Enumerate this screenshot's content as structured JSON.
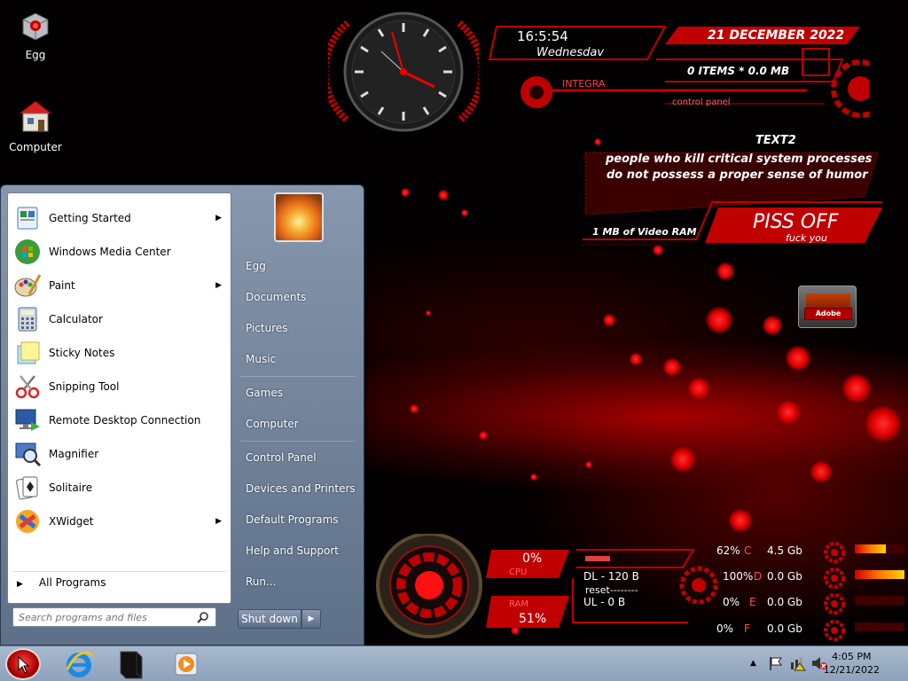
{
  "desktop": {
    "icons": [
      {
        "label": "Egg",
        "icon": "egg-icon"
      },
      {
        "label": "Computer",
        "icon": "computer-icon"
      }
    ],
    "colors": {
      "accent": "#c00000",
      "background": "#020000"
    }
  },
  "widget": {
    "time": "16:5:54",
    "day": "Wednesdav",
    "date": "21 DECEMBER 2022",
    "items": "0 ITEMS * 0.0 MB",
    "integra": "INTEGRA",
    "control_panel": "control  panel",
    "text2_title": "TEXT2",
    "text2_line1": "people who kill critical system processes",
    "text2_line2": "do not possess a proper sense of humor",
    "video_ram": "1 MB of Video RAM",
    "piss_off": "PISS OFF",
    "fuck_you": "fuck you",
    "adobe": "Adobe"
  },
  "start_menu": {
    "programs": [
      {
        "label": "Getting Started",
        "icon": "getting-started-icon",
        "has_submenu": true
      },
      {
        "label": "Windows Media Center",
        "icon": "media-center-icon",
        "has_submenu": false
      },
      {
        "label": "Paint",
        "icon": "paint-icon",
        "has_submenu": true
      },
      {
        "label": "Calculator",
        "icon": "calculator-icon",
        "has_submenu": false
      },
      {
        "label": "Sticky Notes",
        "icon": "sticky-notes-icon",
        "has_submenu": false
      },
      {
        "label": "Snipping Tool",
        "icon": "snipping-tool-icon",
        "has_submenu": false
      },
      {
        "label": "Remote Desktop Connection",
        "icon": "remote-desktop-icon",
        "has_submenu": false
      },
      {
        "label": "Magnifier",
        "icon": "magnifier-icon",
        "has_submenu": false
      },
      {
        "label": "Solitaire",
        "icon": "solitaire-icon",
        "has_submenu": false
      },
      {
        "label": "XWidget",
        "icon": "xwidget-icon",
        "has_submenu": true
      }
    ],
    "all_programs": "All Programs",
    "search_placeholder": "Search programs and files",
    "right_items": [
      "Egg",
      "Documents",
      "Pictures",
      "Music",
      "Games",
      "Computer",
      "Control Panel",
      "Devices and Printers",
      "Default Programs",
      "Help and Support",
      "Run..."
    ],
    "shutdown": "Shut down"
  },
  "monitor": {
    "cpu_percent": "0%",
    "cpu_label": "CPU",
    "ram_label": "RAM",
    "ram_percent": "51%",
    "dl": "DL - 120 B",
    "reset": "reset--------",
    "ul": "UL - 0 B",
    "drives": [
      {
        "percent": "62%",
        "letter": "C",
        "size": "4.5 Gb",
        "fill": 0.62
      },
      {
        "percent": "100%",
        "letter": "D",
        "size": "0.0 Gb",
        "fill": 1.0
      },
      {
        "percent": "0%",
        "letter": "E",
        "size": "0.0 Gb",
        "fill": 0
      },
      {
        "percent": "0%",
        "letter": "F",
        "size": "0.0 Gb",
        "fill": 0
      }
    ]
  },
  "taskbar": {
    "time": "4:05 PM",
    "date": "12/21/2022",
    "pinned": [
      "internet-explorer-icon",
      "game-console-icon",
      "media-player-icon"
    ]
  }
}
